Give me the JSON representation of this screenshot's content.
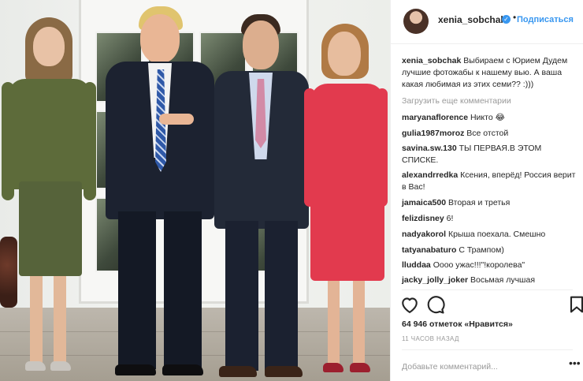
{
  "post": {
    "author": "xenia_sobchak",
    "follow_label": "Подписаться",
    "separator": "•",
    "caption_user": "xenia_sobchak",
    "caption_text": "Выбираем с Юрием Дудем лучшие фотожабы к нашему вью. А ваша какая любимая из этих семи?? :)))",
    "load_more_label": "Загрузить еще комментарии",
    "likes_text": "64 946 отметок «Нравится»",
    "timestamp": "11 часов назад",
    "add_comment_placeholder": "Добавьте комментарий...",
    "more_label": "•••"
  },
  "comments": [
    {
      "user": "maryanaflorence",
      "text": "Никто 😂"
    },
    {
      "user": "gulia1987moroz",
      "text": "Все отстой"
    },
    {
      "user": "savina.sw.130",
      "text": "ТЫ ПЕРВАЯ.В ЭТОМ СПИСКЕ."
    },
    {
      "user": "alexandrredka",
      "text": "Ксения, вперёд! Россия верит в Вас!"
    },
    {
      "user": "jamaica500",
      "text": "Вторая и третья"
    },
    {
      "user": "felizdisney",
      "text": "6!"
    },
    {
      "user": "nadyakorol",
      "text": "Крыша поехала. Смешно"
    },
    {
      "user": "tatyanabaturo",
      "text": "С Трампом)"
    },
    {
      "user": "lluddaa",
      "text": "Оооо ужас!!!\"!королева\""
    },
    {
      "user": "jacky_jolly_joker",
      "text": "Восьмая лучшая"
    }
  ],
  "icons": {
    "verified": "verified-badge-icon",
    "like": "heart-icon",
    "comment": "comment-bubble-icon",
    "save": "bookmark-icon",
    "verified_glyph": "✓"
  },
  "colors": {
    "link_blue": "#3897f0",
    "text": "#262626",
    "muted": "#999999",
    "border": "#efefef"
  }
}
